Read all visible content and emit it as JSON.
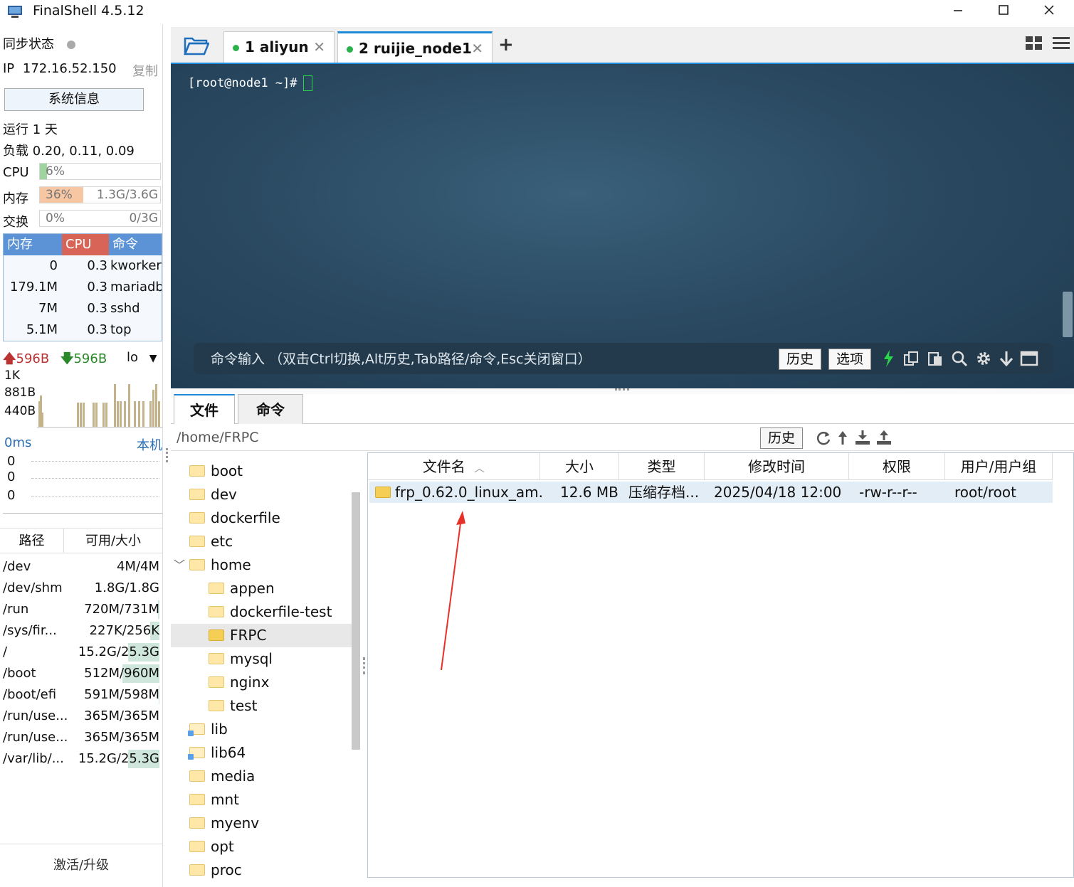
{
  "window": {
    "title": "FinalShell 4.5.12",
    "controls": [
      "minimize-icon",
      "maximize-icon",
      "close-icon"
    ]
  },
  "sidebar": {
    "sync_label": "同步状态",
    "ip_label": "IP",
    "ip_value": "172.16.52.150",
    "copy_label": "复制",
    "sysinfo_button": "系统信息",
    "uptime": "运行 1 天",
    "load": "负载 0.20, 0.11, 0.09",
    "cpu": {
      "label": "CPU",
      "percent": "6%",
      "fraction": 0.06
    },
    "mem": {
      "label": "内存",
      "percent": "36%",
      "amount": "1.3G/3.6G",
      "fraction": 0.36
    },
    "swap": {
      "label": "交换",
      "percent": "0%",
      "amount": "0/3G",
      "fraction": 0
    },
    "process_table": {
      "headers": [
        "内存",
        "CPU",
        "命令"
      ],
      "rows": [
        {
          "mem": "0",
          "cpu": "0.3",
          "cmd": "kworker/"
        },
        {
          "mem": "179.1M",
          "cpu": "0.3",
          "cmd": "mariadb"
        },
        {
          "mem": "7M",
          "cpu": "0.3",
          "cmd": "sshd"
        },
        {
          "mem": "5.1M",
          "cpu": "0.3",
          "cmd": "top"
        }
      ]
    },
    "network": {
      "up": "596B",
      "down": "596B",
      "interface": "lo",
      "scale": [
        "1K",
        "881B",
        "440B"
      ]
    },
    "ping": {
      "latency": "0ms",
      "host": "本机",
      "values": [
        "0",
        "0",
        "0"
      ]
    },
    "disk_table": {
      "headers": [
        "路径",
        "可用/大小"
      ],
      "rows": [
        {
          "path": "/dev",
          "size": "4M/4M",
          "used": 0.0
        },
        {
          "path": "/dev/shm",
          "size": "1.8G/1.8G",
          "used": 0.0
        },
        {
          "path": "/run",
          "size": "720M/731M",
          "used": 0.02
        },
        {
          "path": "/sys/fir...",
          "size": "227K/256K",
          "used": 0.12
        },
        {
          "path": "/",
          "size": "15.2G/25.3G",
          "used": 0.4
        },
        {
          "path": "/boot",
          "size": "512M/960M",
          "used": 0.47
        },
        {
          "path": "/boot/efi",
          "size": "591M/598M",
          "used": 0.01
        },
        {
          "path": "/run/use...",
          "size": "365M/365M",
          "used": 0.0
        },
        {
          "path": "/run/use...",
          "size": "365M/365M",
          "used": 0.0
        },
        {
          "path": "/var/lib/...",
          "size": "15.2G/25.3G",
          "used": 0.4
        }
      ]
    },
    "activate_label": "激活/升级"
  },
  "session_tabs": [
    {
      "label": "1 aliyun",
      "active": false
    },
    {
      "label": "2 ruijie_node1",
      "active": true
    }
  ],
  "terminal": {
    "prompt": "[root@node1 ~]#",
    "command_bar": {
      "placeholder": "命令输入 （双击Ctrl切换,Alt历史,Tab路径/命令,Esc关闭窗口）",
      "history_button": "历史",
      "options_button": "选项",
      "icons": [
        "lightning-icon",
        "copy-icon",
        "paste-icon",
        "search-icon",
        "gear-icon",
        "download-icon",
        "window-icon"
      ]
    }
  },
  "file_panel": {
    "tabs": [
      "文件",
      "命令"
    ],
    "path": "/home/FRPC",
    "history_button": "历史",
    "tree": [
      {
        "name": "boot",
        "level": 0
      },
      {
        "name": "dev",
        "level": 0
      },
      {
        "name": "dockerfile",
        "level": 0
      },
      {
        "name": "etc",
        "level": 0
      },
      {
        "name": "home",
        "level": 0,
        "expanded": true
      },
      {
        "name": "appen",
        "level": 1
      },
      {
        "name": "dockerfile-test",
        "level": 1
      },
      {
        "name": "FRPC",
        "level": 1,
        "selected": true
      },
      {
        "name": "mysql",
        "level": 1
      },
      {
        "name": "nginx",
        "level": 1
      },
      {
        "name": "test",
        "level": 1
      },
      {
        "name": "lib",
        "level": 0,
        "link": true
      },
      {
        "name": "lib64",
        "level": 0,
        "link": true
      },
      {
        "name": "media",
        "level": 0
      },
      {
        "name": "mnt",
        "level": 0
      },
      {
        "name": "myenv",
        "level": 0
      },
      {
        "name": "opt",
        "level": 0
      },
      {
        "name": "proc",
        "level": 0
      }
    ],
    "columns": [
      "文件名",
      "大小",
      "类型",
      "修改时间",
      "权限",
      "用户/用户组"
    ],
    "files": [
      {
        "name": "frp_0.62.0_linux_am...",
        "size": "12.6 MB",
        "type": "压缩存档...",
        "modified": "2025/04/18 12:00",
        "perm": "-rw-r--r--",
        "owner": "root/root"
      }
    ]
  },
  "colors": {
    "accent": "#1f8ad8",
    "cpu_fill": "#9fd39f",
    "mem_fill": "#f7c6a3",
    "proc_header_mem": "#5b93d6",
    "proc_header_cpu": "#d76456",
    "proc_header_cmd": "#5b93d6",
    "net_bar": "#c3b28a",
    "status_green": "#2ab24a",
    "arrow": "#e8302a"
  }
}
